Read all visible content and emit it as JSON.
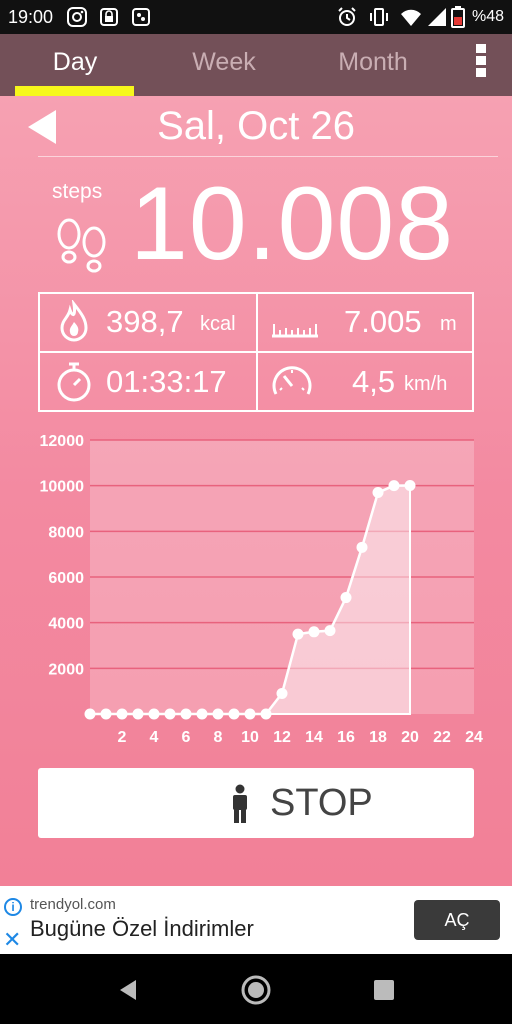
{
  "status_bar": {
    "time": "19:00",
    "battery_percent": "%48",
    "left_icons": [
      "instagram-icon",
      "lock-icon",
      "app-icon"
    ],
    "right_icons": [
      "alarm-icon",
      "vibrate-icon",
      "wifi-icon",
      "signal-icon",
      "battery-icon"
    ]
  },
  "tabs": [
    {
      "label": "Day",
      "active": true
    },
    {
      "label": "Week",
      "active": false
    },
    {
      "label": "Month",
      "active": false
    }
  ],
  "accent_color": "#f6f71c",
  "date": "Sal, Oct 26",
  "steps": {
    "label": "steps",
    "value": "10.008"
  },
  "stats": {
    "calories": {
      "value": "398,7",
      "unit": "kcal"
    },
    "distance": {
      "value": "7.005",
      "unit": "m"
    },
    "duration": {
      "value": "01:33:17"
    },
    "speed": {
      "value": "4,5",
      "unit": "km/h"
    }
  },
  "chart_data": {
    "type": "area",
    "x": [
      0,
      1,
      2,
      3,
      4,
      5,
      6,
      7,
      8,
      9,
      10,
      11,
      12,
      13,
      14,
      15,
      16,
      17,
      18,
      19,
      20
    ],
    "y": [
      0,
      0,
      0,
      0,
      0,
      0,
      0,
      0,
      0,
      0,
      0,
      0,
      900,
      3500,
      3600,
      3650,
      5100,
      7300,
      9700,
      10000,
      10008
    ],
    "x_ticks": [
      2,
      4,
      6,
      8,
      10,
      12,
      14,
      16,
      18,
      20,
      22,
      24
    ],
    "y_ticks": [
      2000,
      4000,
      6000,
      8000,
      10000,
      12000
    ],
    "xlim": [
      0,
      24
    ],
    "ylim": [
      0,
      12000
    ],
    "grid": true
  },
  "stop_button": {
    "label": "STOP"
  },
  "ad": {
    "domain": "trendyol.com",
    "headline": "Bugüne Özel İndirimler",
    "cta": "AÇ",
    "info_label": "i",
    "close_label": "✕"
  }
}
